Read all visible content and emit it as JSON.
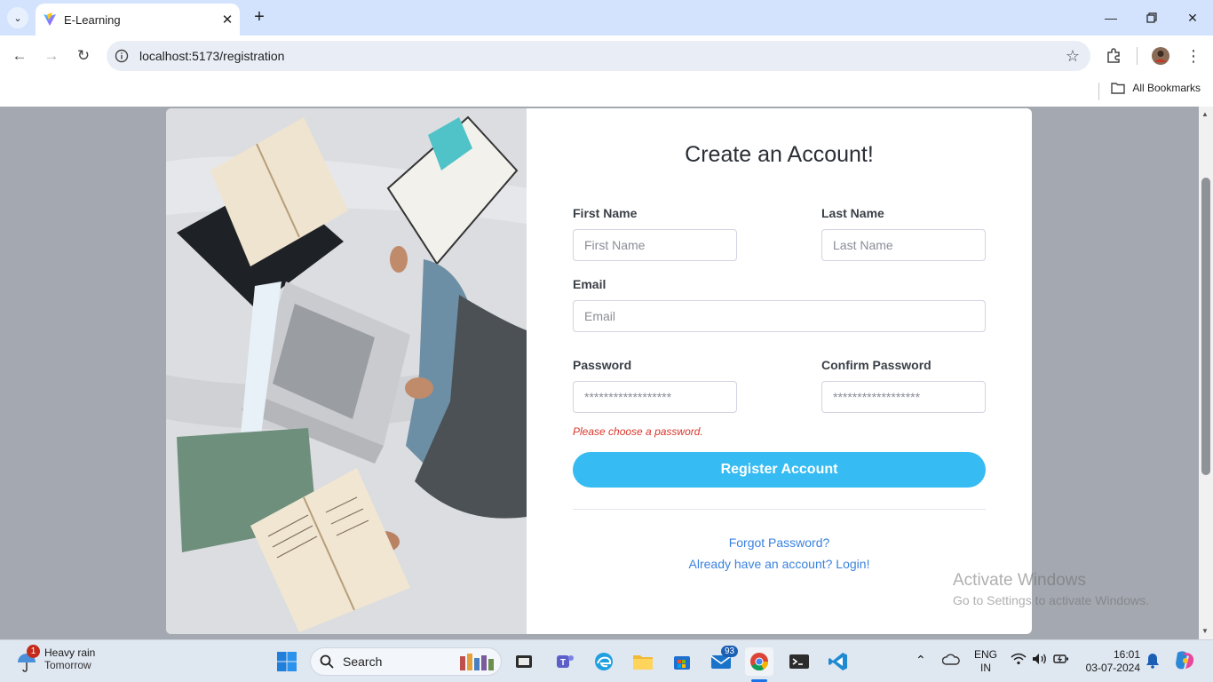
{
  "browser": {
    "tab_title": "E-Learning",
    "url": "localhost:5173/registration",
    "bookmarks_label": "All Bookmarks"
  },
  "form": {
    "heading": "Create an Account!",
    "first_name_label": "First Name",
    "first_name_placeholder": "First Name",
    "last_name_label": "Last Name",
    "last_name_placeholder": "Last Name",
    "email_label": "Email",
    "email_placeholder": "Email",
    "password_label": "Password",
    "password_placeholder": "******************",
    "confirm_password_label": "Confirm Password",
    "confirm_password_placeholder": "******************",
    "error": "Please choose a password.",
    "submit_label": "Register Account",
    "forgot_link": "Forgot Password?",
    "login_link": "Already have an account? Login!"
  },
  "watermark": {
    "line1": "Activate Windows",
    "line2": "Go to Settings to activate Windows."
  },
  "taskbar": {
    "weather_title": "Heavy rain",
    "weather_sub": "Tomorrow",
    "weather_badge": "1",
    "search_label": "Search",
    "mail_badge": "93",
    "lang_top": "ENG",
    "lang_bottom": "IN",
    "time": "16:01",
    "date": "03-07-2024"
  },
  "colors": {
    "accent": "#36bbf2",
    "error": "#d9362b",
    "link": "#3a82e0",
    "page_bg": "#a4a8b1"
  }
}
